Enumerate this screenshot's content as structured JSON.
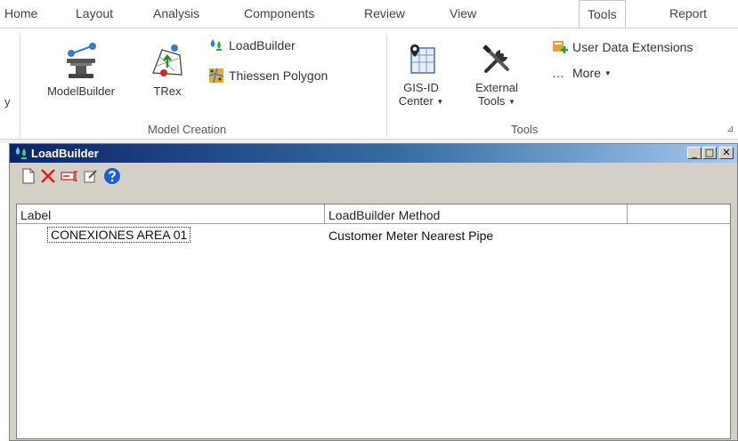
{
  "ribbon": {
    "tabs": [
      "Home",
      "Layout",
      "Analysis",
      "Components",
      "Review",
      "View",
      "Tools",
      "Report"
    ],
    "active_tab": "Tools",
    "partial_left_label": "y",
    "model_creation": {
      "group_label": "Model Creation",
      "modelbuilder_label": "ModelBuilder",
      "trex_label": "TRex",
      "loadbuilder_label": "LoadBuilder",
      "thiessen_label": "Thiessen Polygon"
    },
    "tools": {
      "group_label": "Tools",
      "gisid_line1": "GIS-ID",
      "gisid_line2": "Center",
      "external_line1": "External",
      "external_line2": "Tools",
      "user_data_label": "User Data Extensions",
      "more_label": "More",
      "more_prefix": "…"
    }
  },
  "window": {
    "title": "LoadBuilder",
    "controls": {
      "minimize": "_",
      "maximize": "□",
      "close": "✕"
    },
    "toolbar_icons": [
      "new-icon",
      "delete-icon",
      "rename-icon",
      "edit-icon",
      "help-icon"
    ],
    "columns": [
      "Label",
      "LoadBuilder Method",
      ""
    ],
    "rows": [
      {
        "label": "CONEXIONES AREA 01",
        "method": "Customer Meter Nearest Pipe"
      }
    ]
  },
  "colors": {
    "title_gradient_start": "#0a246a",
    "title_gradient_end": "#a6caf0",
    "delete_red": "#e02020",
    "help_blue": "#1a5fd0"
  }
}
